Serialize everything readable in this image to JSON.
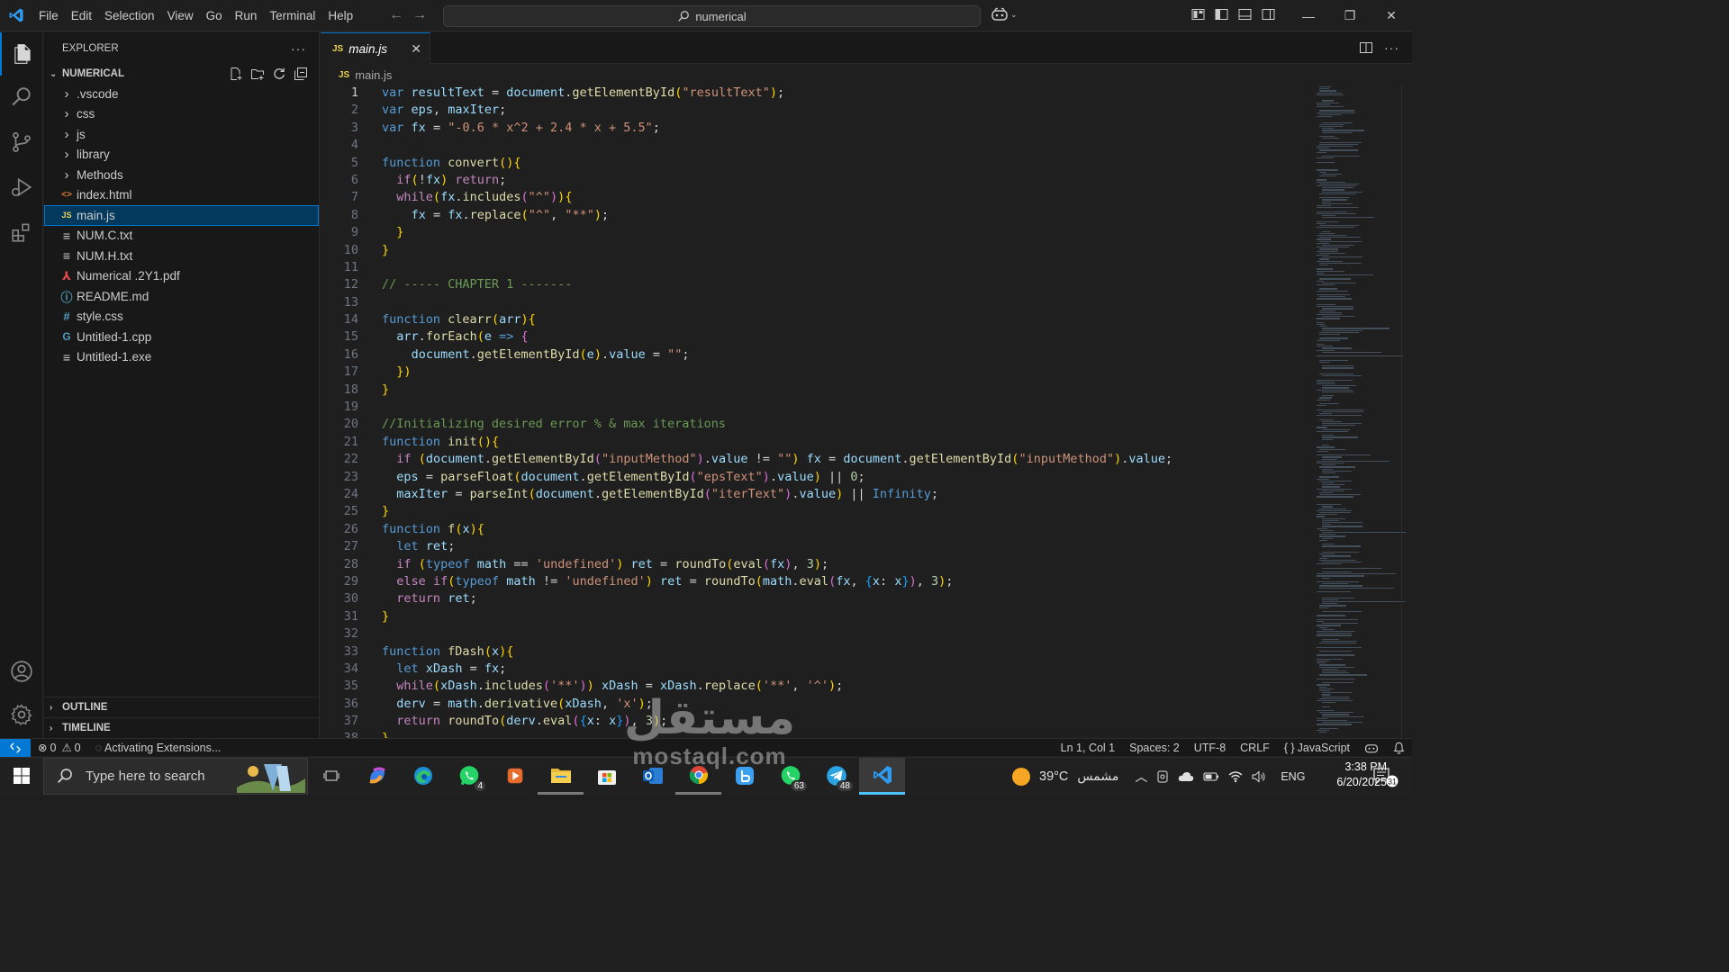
{
  "titlebar": {
    "menu": [
      "File",
      "Edit",
      "Selection",
      "View",
      "Go",
      "Run",
      "Terminal",
      "Help"
    ],
    "search": "numerical"
  },
  "sidebar": {
    "title": "EXPLORER",
    "more": "···",
    "folder": "NUMERICAL",
    "items": [
      {
        "label": ".vscode",
        "kind": "folder"
      },
      {
        "label": "css",
        "kind": "folder"
      },
      {
        "label": "js",
        "kind": "folder"
      },
      {
        "label": "library",
        "kind": "folder"
      },
      {
        "label": "Methods",
        "kind": "folder"
      },
      {
        "label": "index.html",
        "kind": "html"
      },
      {
        "label": "main.js",
        "kind": "js",
        "selected": true
      },
      {
        "label": "NUM.C.txt",
        "kind": "txt"
      },
      {
        "label": "NUM.H.txt",
        "kind": "txt"
      },
      {
        "label": "Numerical .2Y1.pdf",
        "kind": "pdf"
      },
      {
        "label": "README.md",
        "kind": "md"
      },
      {
        "label": "style.css",
        "kind": "css"
      },
      {
        "label": "Untitled-1.cpp",
        "kind": "cpp"
      },
      {
        "label": "Untitled-1.exe",
        "kind": "txt"
      }
    ],
    "outline": "OUTLINE",
    "timeline": "TIMELINE"
  },
  "editor": {
    "tab_label": "main.js",
    "tab_badge": "JS",
    "breadcrumb": "main.js",
    "line_numbers": [
      "1",
      "2",
      "3",
      "4",
      "5",
      "6",
      "7",
      "8",
      "9",
      "10",
      "11",
      "12",
      "13",
      "14",
      "15",
      "16",
      "17",
      "18",
      "19",
      "20",
      "21",
      "22",
      "23",
      "24",
      "25",
      "26",
      "27",
      "28",
      "29",
      "30",
      "31",
      "32",
      "33",
      "34",
      "35",
      "36",
      "37",
      "38"
    ],
    "lines": [
      "var resultText = document.getElementById(\"resultText\");",
      "var eps, maxIter;",
      "var fx = \"-0.6 * x^2 + 2.4 * x + 5.5\";",
      "",
      "function convert(){",
      "  if(!fx) return;",
      "  while(fx.includes(\"^\")){",
      "    fx = fx.replace(\"^\", \"**\");",
      "  }",
      "}",
      "",
      "// ----- CHAPTER 1 -------",
      "",
      "function clearr(arr){",
      "  arr.forEach(e => {",
      "    document.getElementById(e).value = \"\";",
      "  })",
      "}",
      "",
      "//Initializing desired error % & max iterations",
      "function init(){",
      "  if (document.getElementById(\"inputMethod\").value != \"\") fx = document.getElementById(\"inputMethod\").value;",
      "  eps = parseFloat(document.getElementById(\"epsText\").value) || 0;",
      "  maxIter = parseInt(document.getElementById(\"iterText\").value) || Infinity;",
      "}",
      "function f(x){",
      "  let ret;",
      "  if (typeof math == 'undefined') ret = roundTo(eval(fx), 3);",
      "  else if(typeof math != 'undefined') ret = roundTo(math.eval(fx, {x: x}), 3);",
      "  return ret;",
      "}",
      "",
      "function fDash(x){",
      "  let xDash = fx;",
      "  while(xDash.includes('**')) xDash = xDash.replace('**', '^');",
      "  derv = math.derivative(xDash, 'x');",
      "  return roundTo(derv.eval({x: x}), 3);",
      "}"
    ]
  },
  "statusbar": {
    "errors": "0",
    "warnings": "0",
    "activity": "Activating Extensions...",
    "position": "Ln 1, Col 1",
    "spaces": "Spaces: 2",
    "encoding": "UTF-8",
    "eol": "CRLF",
    "language": "JavaScript"
  },
  "taskbar": {
    "search_placeholder": "Type here to search",
    "badges": {
      "whatsapp": "4",
      "whatsapp2": "63",
      "telegram": "48"
    },
    "weather": "39°C",
    "weather_text": "مشمس",
    "lang": "ENG",
    "time": "3:38 PM",
    "date": "6/20/2025",
    "notifications": "31"
  },
  "watermark": {
    "arabic": "مستقل",
    "latin": "mostaql.com"
  },
  "colors": {
    "accent": "#0078d4",
    "selection": "#04395e",
    "background": "#1f1f1f"
  }
}
